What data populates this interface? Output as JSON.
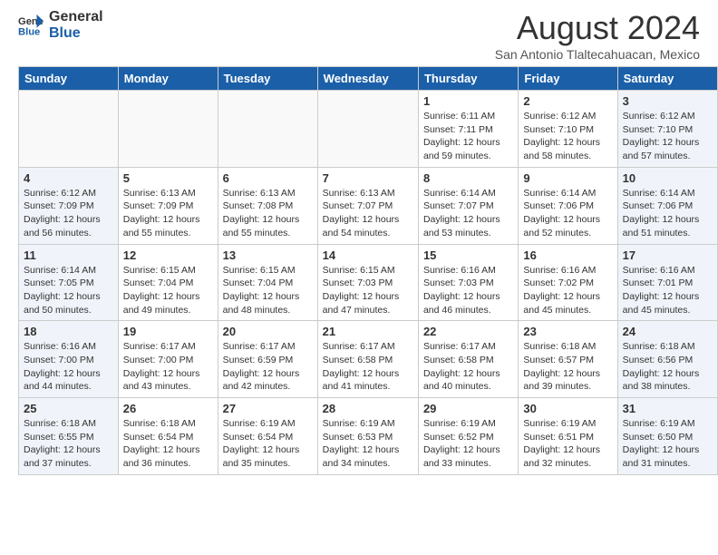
{
  "header": {
    "logo_general": "General",
    "logo_blue": "Blue",
    "month_year": "August 2024",
    "location": "San Antonio Tlaltecahuacan, Mexico"
  },
  "days_of_week": [
    "Sunday",
    "Monday",
    "Tuesday",
    "Wednesday",
    "Thursday",
    "Friday",
    "Saturday"
  ],
  "weeks": [
    [
      {
        "day": "",
        "info": "",
        "type": "empty"
      },
      {
        "day": "",
        "info": "",
        "type": "empty"
      },
      {
        "day": "",
        "info": "",
        "type": "empty"
      },
      {
        "day": "",
        "info": "",
        "type": "empty"
      },
      {
        "day": "1",
        "info": "Sunrise: 6:11 AM\nSunset: 7:11 PM\nDaylight: 12 hours\nand 59 minutes.",
        "type": "weekday"
      },
      {
        "day": "2",
        "info": "Sunrise: 6:12 AM\nSunset: 7:10 PM\nDaylight: 12 hours\nand 58 minutes.",
        "type": "weekday"
      },
      {
        "day": "3",
        "info": "Sunrise: 6:12 AM\nSunset: 7:10 PM\nDaylight: 12 hours\nand 57 minutes.",
        "type": "weekend"
      }
    ],
    [
      {
        "day": "4",
        "info": "Sunrise: 6:12 AM\nSunset: 7:09 PM\nDaylight: 12 hours\nand 56 minutes.",
        "type": "weekend"
      },
      {
        "day": "5",
        "info": "Sunrise: 6:13 AM\nSunset: 7:09 PM\nDaylight: 12 hours\nand 55 minutes.",
        "type": "weekday"
      },
      {
        "day": "6",
        "info": "Sunrise: 6:13 AM\nSunset: 7:08 PM\nDaylight: 12 hours\nand 55 minutes.",
        "type": "weekday"
      },
      {
        "day": "7",
        "info": "Sunrise: 6:13 AM\nSunset: 7:07 PM\nDaylight: 12 hours\nand 54 minutes.",
        "type": "weekday"
      },
      {
        "day": "8",
        "info": "Sunrise: 6:14 AM\nSunset: 7:07 PM\nDaylight: 12 hours\nand 53 minutes.",
        "type": "weekday"
      },
      {
        "day": "9",
        "info": "Sunrise: 6:14 AM\nSunset: 7:06 PM\nDaylight: 12 hours\nand 52 minutes.",
        "type": "weekday"
      },
      {
        "day": "10",
        "info": "Sunrise: 6:14 AM\nSunset: 7:06 PM\nDaylight: 12 hours\nand 51 minutes.",
        "type": "weekend"
      }
    ],
    [
      {
        "day": "11",
        "info": "Sunrise: 6:14 AM\nSunset: 7:05 PM\nDaylight: 12 hours\nand 50 minutes.",
        "type": "weekend"
      },
      {
        "day": "12",
        "info": "Sunrise: 6:15 AM\nSunset: 7:04 PM\nDaylight: 12 hours\nand 49 minutes.",
        "type": "weekday"
      },
      {
        "day": "13",
        "info": "Sunrise: 6:15 AM\nSunset: 7:04 PM\nDaylight: 12 hours\nand 48 minutes.",
        "type": "weekday"
      },
      {
        "day": "14",
        "info": "Sunrise: 6:15 AM\nSunset: 7:03 PM\nDaylight: 12 hours\nand 47 minutes.",
        "type": "weekday"
      },
      {
        "day": "15",
        "info": "Sunrise: 6:16 AM\nSunset: 7:03 PM\nDaylight: 12 hours\nand 46 minutes.",
        "type": "weekday"
      },
      {
        "day": "16",
        "info": "Sunrise: 6:16 AM\nSunset: 7:02 PM\nDaylight: 12 hours\nand 45 minutes.",
        "type": "weekday"
      },
      {
        "day": "17",
        "info": "Sunrise: 6:16 AM\nSunset: 7:01 PM\nDaylight: 12 hours\nand 45 minutes.",
        "type": "weekend"
      }
    ],
    [
      {
        "day": "18",
        "info": "Sunrise: 6:16 AM\nSunset: 7:00 PM\nDaylight: 12 hours\nand 44 minutes.",
        "type": "weekend"
      },
      {
        "day": "19",
        "info": "Sunrise: 6:17 AM\nSunset: 7:00 PM\nDaylight: 12 hours\nand 43 minutes.",
        "type": "weekday"
      },
      {
        "day": "20",
        "info": "Sunrise: 6:17 AM\nSunset: 6:59 PM\nDaylight: 12 hours\nand 42 minutes.",
        "type": "weekday"
      },
      {
        "day": "21",
        "info": "Sunrise: 6:17 AM\nSunset: 6:58 PM\nDaylight: 12 hours\nand 41 minutes.",
        "type": "weekday"
      },
      {
        "day": "22",
        "info": "Sunrise: 6:17 AM\nSunset: 6:58 PM\nDaylight: 12 hours\nand 40 minutes.",
        "type": "weekday"
      },
      {
        "day": "23",
        "info": "Sunrise: 6:18 AM\nSunset: 6:57 PM\nDaylight: 12 hours\nand 39 minutes.",
        "type": "weekday"
      },
      {
        "day": "24",
        "info": "Sunrise: 6:18 AM\nSunset: 6:56 PM\nDaylight: 12 hours\nand 38 minutes.",
        "type": "weekend"
      }
    ],
    [
      {
        "day": "25",
        "info": "Sunrise: 6:18 AM\nSunset: 6:55 PM\nDaylight: 12 hours\nand 37 minutes.",
        "type": "weekend"
      },
      {
        "day": "26",
        "info": "Sunrise: 6:18 AM\nSunset: 6:54 PM\nDaylight: 12 hours\nand 36 minutes.",
        "type": "weekday"
      },
      {
        "day": "27",
        "info": "Sunrise: 6:19 AM\nSunset: 6:54 PM\nDaylight: 12 hours\nand 35 minutes.",
        "type": "weekday"
      },
      {
        "day": "28",
        "info": "Sunrise: 6:19 AM\nSunset: 6:53 PM\nDaylight: 12 hours\nand 34 minutes.",
        "type": "weekday"
      },
      {
        "day": "29",
        "info": "Sunrise: 6:19 AM\nSunset: 6:52 PM\nDaylight: 12 hours\nand 33 minutes.",
        "type": "weekday"
      },
      {
        "day": "30",
        "info": "Sunrise: 6:19 AM\nSunset: 6:51 PM\nDaylight: 12 hours\nand 32 minutes.",
        "type": "weekday"
      },
      {
        "day": "31",
        "info": "Sunrise: 6:19 AM\nSunset: 6:50 PM\nDaylight: 12 hours\nand 31 minutes.",
        "type": "weekend"
      }
    ]
  ]
}
